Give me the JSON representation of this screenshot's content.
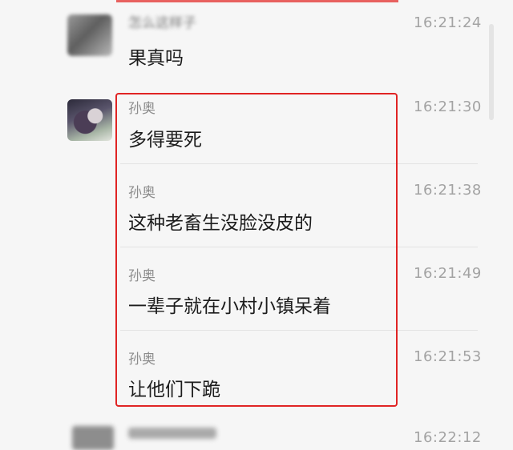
{
  "messages": [
    {
      "sender": "怎么这样子",
      "time": "16:21:24",
      "text": "果真吗"
    },
    {
      "sender": "孙奥",
      "time": "16:21:30",
      "text": "多得要死"
    },
    {
      "sender": "孙奥",
      "time": "16:21:38",
      "text": "这种老畜生没脸没皮的"
    },
    {
      "sender": "孙奥",
      "time": "16:21:49",
      "text": "一辈子就在小村小镇呆着"
    },
    {
      "sender": "孙奥",
      "time": "16:21:53",
      "text": "让他们下跪"
    }
  ],
  "bottom_message": {
    "time": "16:22:12"
  },
  "colors": {
    "highlight": "#e02424",
    "background": "#f6f6f6",
    "timestamp": "#a3a3a3"
  }
}
